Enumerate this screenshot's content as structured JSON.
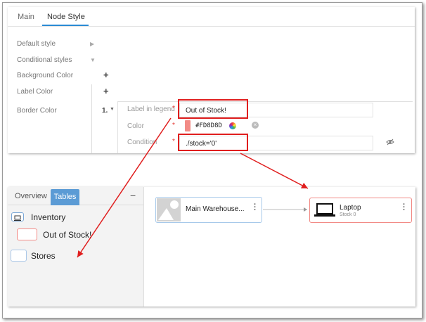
{
  "tabs": {
    "main": "Main",
    "node_style": "Node Style"
  },
  "style_options": {
    "default_style": "Default style",
    "conditional_styles": "Conditional styles",
    "background_color": "Background Color",
    "label_color": "Label Color",
    "border_color": "Border Color",
    "add_symbol": "+"
  },
  "condition_rule": {
    "index": "1.",
    "label_in_legend_label": "Label in legend",
    "label_in_legend_value": "Out of Stock!",
    "color_label": "Color",
    "color_value": "#FD8D8D",
    "condition_label": "Condition",
    "condition_value": "./stock='0'",
    "required_mark": "*"
  },
  "legend_panel": {
    "tabs": [
      "Overview",
      "Tables"
    ],
    "active_tab": "Tables",
    "collapse_symbol": "−",
    "items": [
      "Inventory",
      "Out of Stock!",
      "Stores"
    ]
  },
  "graph": {
    "warehouse_node": {
      "title": "Main Warehouse..."
    },
    "laptop_node": {
      "title": "Laptop",
      "subtitle": "Stock 0"
    }
  },
  "colors": {
    "accent": "#2a8ad4",
    "highlight": "#e01e1e",
    "out_of_stock": "#FD8D8D",
    "tables_tab": "#5b9bd5"
  },
  "icons": [
    "chevron-right-icon",
    "chevron-down-icon",
    "color-wheel-icon",
    "clear-icon",
    "eye-off-icon",
    "monitor-icon",
    "image-placeholder-icon",
    "laptop-icon",
    "kebab-menu-icon"
  ]
}
